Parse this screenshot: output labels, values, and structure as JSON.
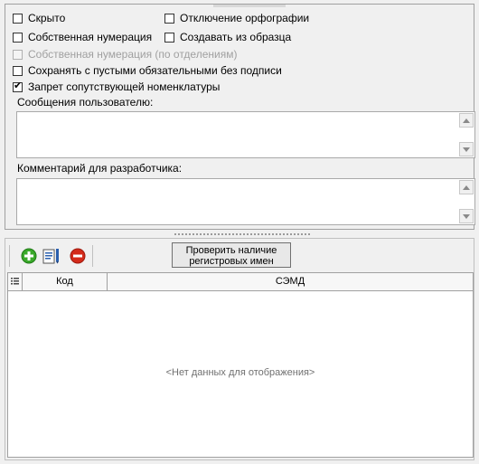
{
  "options": {
    "hidden": {
      "label": "Скрыто",
      "checked": false
    },
    "disable_spelling": {
      "label": "Отключение орфографии",
      "checked": false
    },
    "own_numbering": {
      "label": "Собственная нумерация",
      "checked": false
    },
    "create_from_template": {
      "label": "Создавать из образца",
      "checked": false
    },
    "own_numbering_by_dept": {
      "label": "Собственная нумерация (по отделениям)",
      "checked": false,
      "disabled": true
    },
    "save_with_empty_required": {
      "label": "Сохранять с пустыми обязательными без подписи",
      "checked": false
    },
    "forbid_related_nomenclature": {
      "label": "Запрет сопутствующей номенклатуры",
      "checked": true
    }
  },
  "user_messages": {
    "label": "Сообщения пользователю:",
    "value": ""
  },
  "dev_comment": {
    "label": "Комментарий для разработчика:",
    "value": ""
  },
  "toolbar": {
    "check_button_label": "Проверить наличие регистровых имен",
    "icons": [
      "add-icon",
      "edit-icon",
      "delete-icon"
    ],
    "colors": {
      "add": "#3aa92a",
      "delete": "#d42a1a",
      "edit": "#2a5fae"
    }
  },
  "grid": {
    "columns": [
      "Код",
      "СЭМД"
    ],
    "rows": [],
    "empty_text": "<Нет данных для отображения>"
  }
}
